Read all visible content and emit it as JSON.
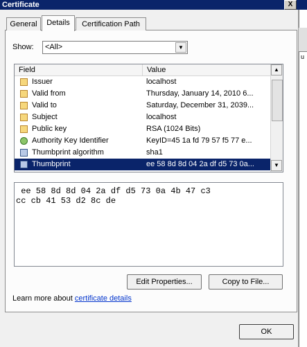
{
  "window": {
    "title": "Certificate",
    "close_label": "X"
  },
  "tabs": [
    {
      "label": "General",
      "active": false
    },
    {
      "label": "Details",
      "active": true
    },
    {
      "label": "Certification Path",
      "active": false
    }
  ],
  "show": {
    "label": "Show:",
    "selected": "<All>"
  },
  "list": {
    "columns": [
      "Field",
      "Value"
    ],
    "rows": [
      {
        "field": "Issuer",
        "value": "localhost",
        "icon": "certificate-field-icon"
      },
      {
        "field": "Valid from",
        "value": "Thursday, January 14, 2010 6...",
        "icon": "certificate-field-icon"
      },
      {
        "field": "Valid to",
        "value": "Saturday, December 31, 2039...",
        "icon": "certificate-field-icon"
      },
      {
        "field": "Subject",
        "value": "localhost",
        "icon": "certificate-field-icon"
      },
      {
        "field": "Public key",
        "value": "RSA (1024 Bits)",
        "icon": "certificate-field-icon"
      },
      {
        "field": "Authority Key Identifier",
        "value": "KeyID=45 1a fd 79 57 f5 77 e...",
        "icon": "extension-icon"
      },
      {
        "field": "Thumbprint algorithm",
        "value": "sha1",
        "icon": "property-icon"
      },
      {
        "field": "Thumbprint",
        "value": "ee 58 8d 8d 04 2a df d5 73 0a...",
        "icon": "property-icon",
        "selected": true
      }
    ]
  },
  "detail": {
    "line1": " ee 58 8d 8d 04 2a df d5 73 0a 4b 47 c3",
    "line2": "cc cb 41 53 d2 8c de"
  },
  "buttons": {
    "edit_properties": "Edit Properties...",
    "copy_to_file": "Copy to File...",
    "ok": "OK"
  },
  "learn": {
    "prefix": "Learn more about ",
    "link": "certificate details"
  },
  "background_window": {
    "fragment": "u"
  },
  "colors": {
    "selection": "#0a246a",
    "titlebar": "#0a246a",
    "link": "#0033cc",
    "dialog_bg": "#f0f0f0"
  }
}
